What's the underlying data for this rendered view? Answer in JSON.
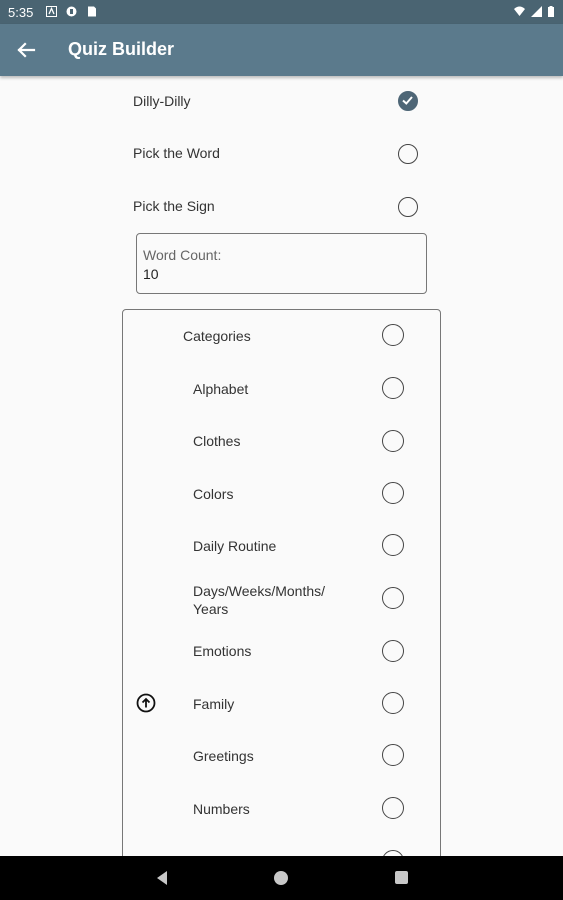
{
  "status_bar": {
    "time": "5:35"
  },
  "app_bar": {
    "title": "Quiz Builder"
  },
  "quiz_types": [
    {
      "label": "Dilly-Dilly",
      "checked": true
    },
    {
      "label": "Pick the Word",
      "checked": false
    },
    {
      "label": "Pick the Sign",
      "checked": false
    }
  ],
  "word_count": {
    "label": "Word Count:",
    "value": "10"
  },
  "categories": {
    "header": "Categories",
    "items": [
      "Alphabet",
      "Clothes",
      "Colors",
      "Daily Routine",
      "Days/Weeks/Months/\nYears",
      "Emotions",
      "Family",
      "Greetings",
      "Numbers"
    ]
  },
  "colors": {
    "app_bar": "#5b7a8c",
    "status_bar": "#4a6472",
    "checked": "#4e6676"
  },
  "icons": {
    "back": "arrow-back-icon",
    "scroll_up": "arrow-up-circle-icon"
  }
}
